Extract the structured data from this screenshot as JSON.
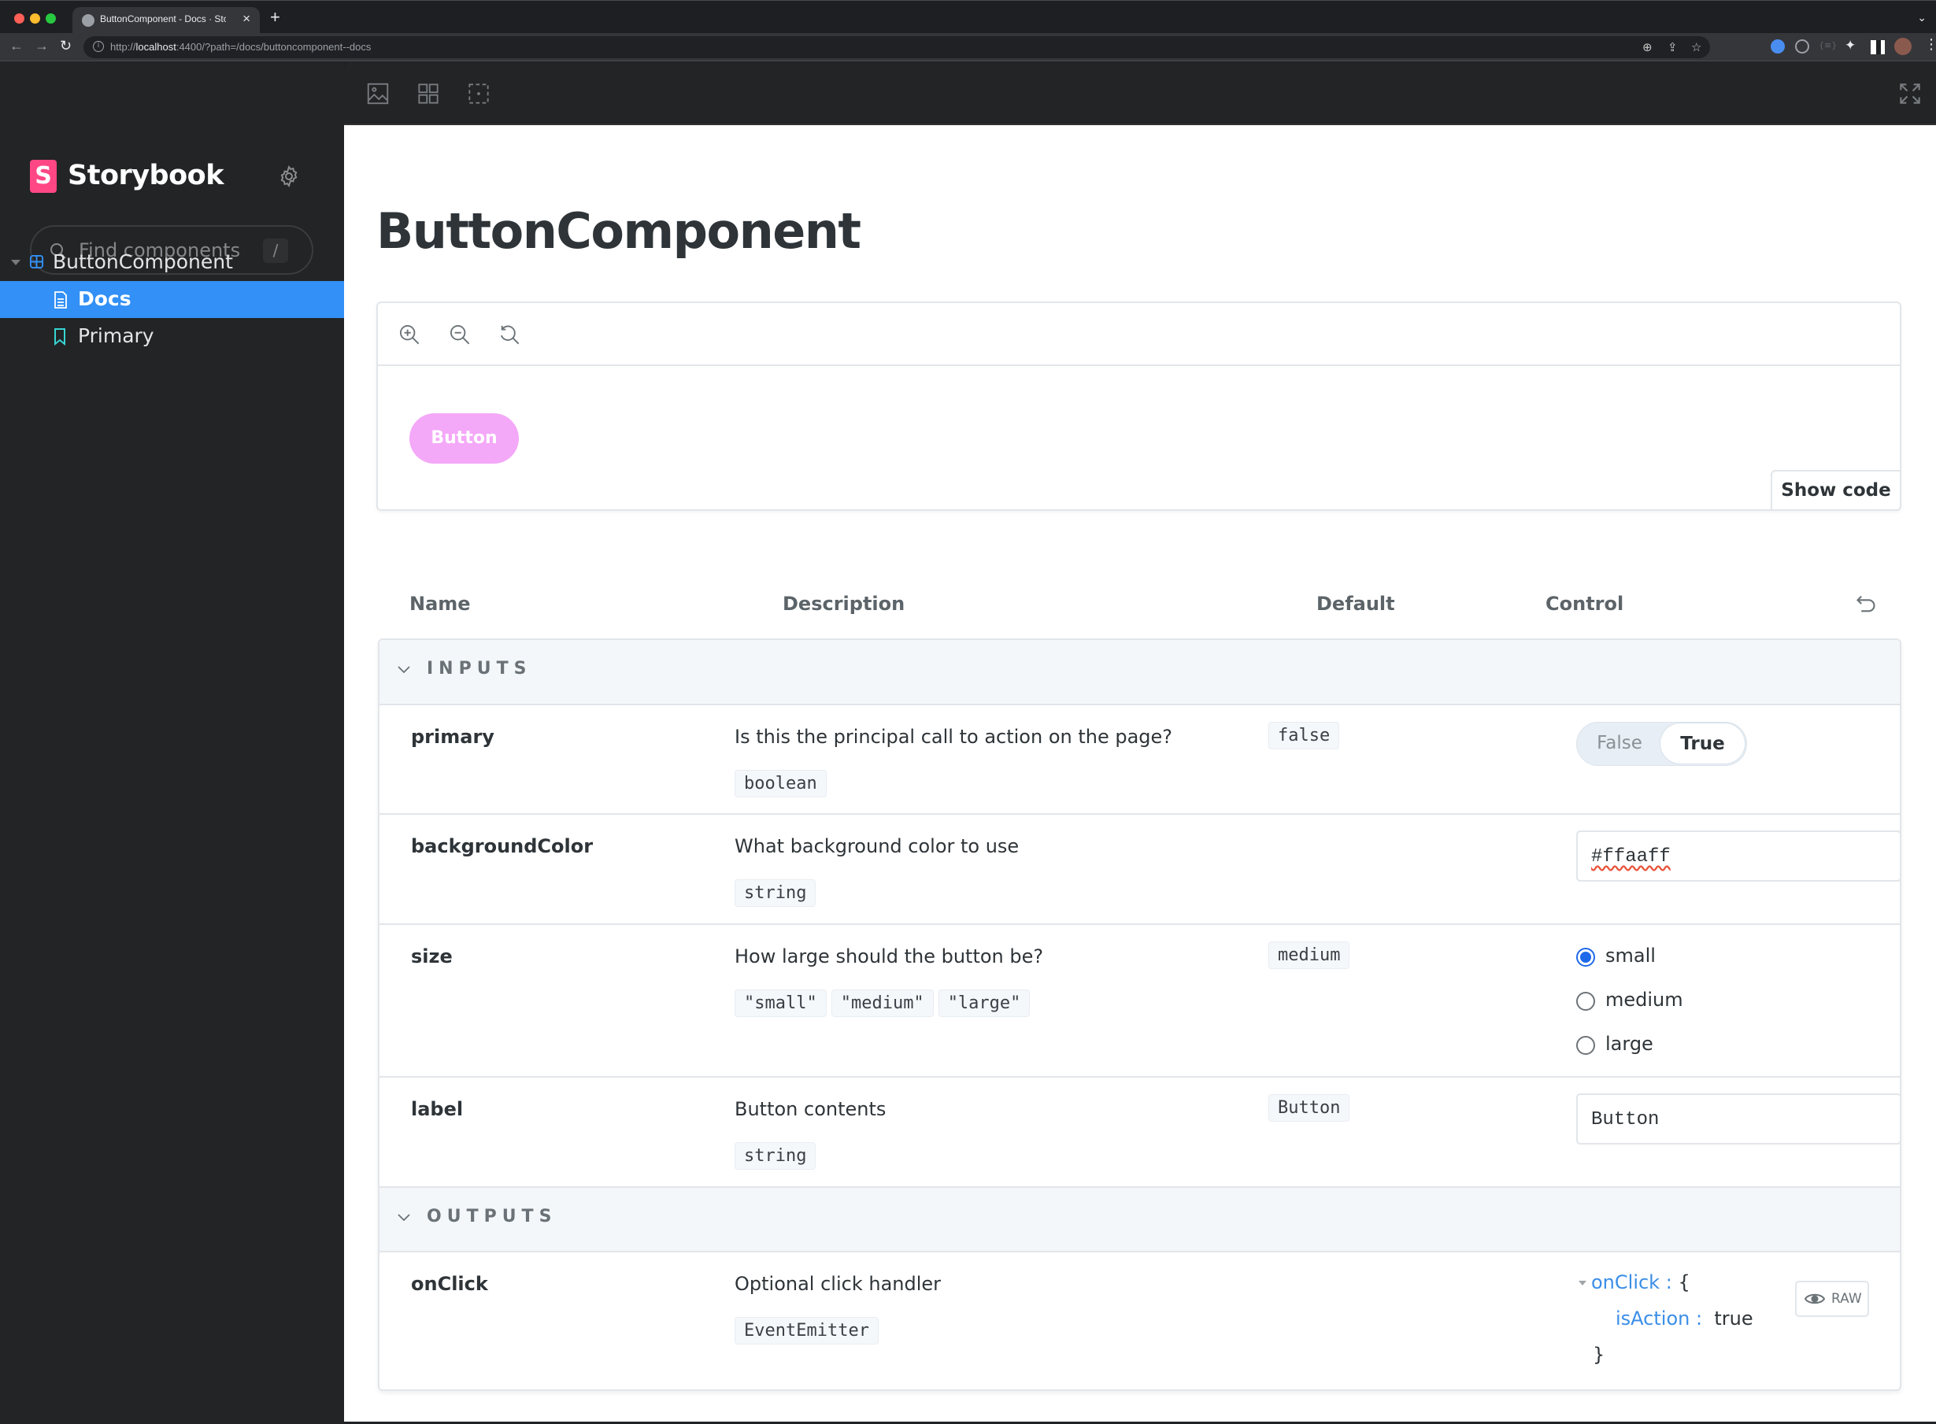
{
  "browser": {
    "tab_title": "ButtonComponent - Docs · Storybook",
    "new_tab_label": "+",
    "url_prefix": "http://",
    "url_host": "localhost",
    "url_rest": ":4400/?path=/docs/buttoncomponent--docs",
    "traffic_colors": [
      "#fe5f57",
      "#febc2e",
      "#28c840"
    ]
  },
  "sidebar": {
    "brand": "Storybook",
    "brand_mark": "S",
    "search_placeholder": "Find components",
    "search_shortcut": "/",
    "tree": [
      {
        "label": "ButtonComponent",
        "type": "component",
        "expanded": true
      },
      {
        "label": "Docs",
        "type": "docs",
        "selected": true
      },
      {
        "label": "Primary",
        "type": "story"
      }
    ]
  },
  "toolbar": {
    "buttons": [
      "background-icon",
      "grid-icon",
      "outline-icon"
    ],
    "fullscreen": "fullscreen-icon"
  },
  "doc": {
    "title": "ButtonComponent",
    "preview": {
      "zoom_tools": [
        "zoom-in",
        "zoom-out",
        "zoom-reset"
      ],
      "demo_button_label": "Button",
      "demo_button_color": "#ffaaff",
      "show_code_label": "Show code"
    },
    "table": {
      "headers": {
        "name": "Name",
        "description": "Description",
        "default": "Default",
        "control": "Control"
      },
      "sections": [
        {
          "label": "INPUTS",
          "rows": [
            {
              "name": "primary",
              "description": "Is this the principal call to action on the page?",
              "types": [
                "boolean"
              ],
              "default": "false",
              "control": {
                "type": "toggle",
                "options": [
                  "False",
                  "True"
                ],
                "value": "True"
              }
            },
            {
              "name": "backgroundColor",
              "description": "What background color to use",
              "types": [
                "string"
              ],
              "default": null,
              "control": {
                "type": "text",
                "value": "#ffaaff"
              }
            },
            {
              "name": "size",
              "description": "How large should the button be?",
              "types": [
                "\"small\"",
                "\"medium\"",
                "\"large\""
              ],
              "default": "medium",
              "control": {
                "type": "radio",
                "options": [
                  "small",
                  "medium",
                  "large"
                ],
                "value": "small"
              }
            },
            {
              "name": "label",
              "description": "Button contents",
              "types": [
                "string"
              ],
              "default": "Button",
              "control": {
                "type": "text",
                "value": "Button"
              }
            }
          ]
        },
        {
          "label": "OUTPUTS",
          "rows": [
            {
              "name": "onClick",
              "description": "Optional click handler",
              "types": [
                "EventEmitter"
              ],
              "default": null,
              "control": {
                "type": "object",
                "key": "onClick",
                "open": "{",
                "close": "}",
                "child_key": "isAction",
                "child_value": "true",
                "raw_label": "RAW"
              }
            }
          ]
        }
      ]
    }
  }
}
